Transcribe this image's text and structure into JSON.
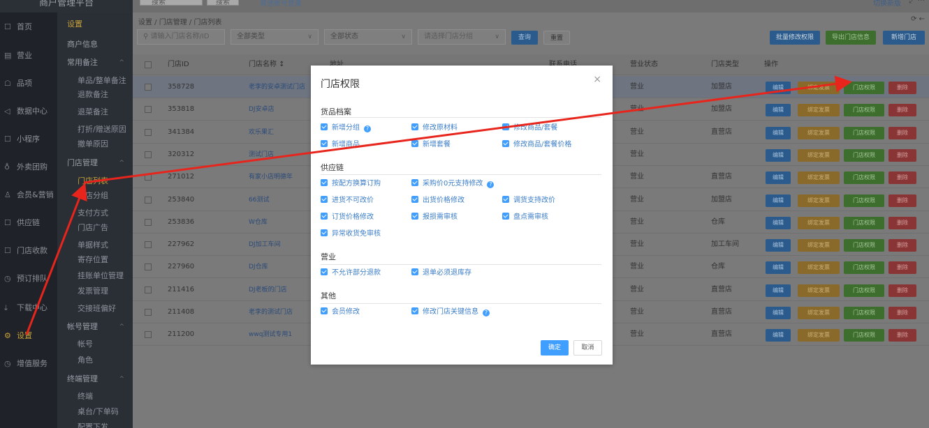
{
  "top": {
    "brand": "商户管理平台",
    "search_value": "搜索",
    "search_btn": "搜索",
    "link": "其他账号登录",
    "right_link": "切换新版",
    "right_icon": "⤢ ···"
  },
  "nav1": [
    {
      "label": "首页",
      "icon": "☐"
    },
    {
      "label": "营业",
      "icon": "▤"
    },
    {
      "label": "品项",
      "icon": "☖"
    },
    {
      "label": "数据中心",
      "icon": "◁"
    },
    {
      "label": "小程序",
      "icon": "☐"
    },
    {
      "label": "外卖团购",
      "icon": "♁"
    },
    {
      "label": "会员&营销",
      "icon": "♙"
    },
    {
      "label": "供应链",
      "icon": "☐"
    },
    {
      "label": "门店收款",
      "icon": "☐"
    },
    {
      "label": "预订排队",
      "icon": "◷"
    },
    {
      "label": "下载中心",
      "icon": "⤓"
    },
    {
      "label": "设置",
      "icon": "⚙"
    },
    {
      "label": "增值服务",
      "icon": "◷"
    }
  ],
  "nav2": {
    "title": "设置",
    "items": [
      {
        "label": "商户信息",
        "type": "grp"
      },
      {
        "label": "常用备注",
        "type": "grp",
        "caret": "^"
      },
      {
        "label": "单品/整单备注",
        "type": "sub"
      },
      {
        "label": "退款备注",
        "type": "sub"
      },
      {
        "label": "退菜备注",
        "type": "sub"
      },
      {
        "label": "打折/赠送原因",
        "type": "sub"
      },
      {
        "label": "撤单原因",
        "type": "sub"
      },
      {
        "label": "门店管理",
        "type": "grp",
        "caret": "^"
      },
      {
        "label": "门店列表",
        "type": "sub",
        "current": true
      },
      {
        "label": "门店分组",
        "type": "sub"
      },
      {
        "label": "支付方式",
        "type": "sub"
      },
      {
        "label": "门店广告",
        "type": "sub"
      },
      {
        "label": "单据样式",
        "type": "sub"
      },
      {
        "label": "寄存位置",
        "type": "sub"
      },
      {
        "label": "挂账单位管理",
        "type": "sub"
      },
      {
        "label": "发票管理",
        "type": "sub"
      },
      {
        "label": "交接班偏好",
        "type": "sub"
      },
      {
        "label": "帐号管理",
        "type": "grp",
        "caret": "^"
      },
      {
        "label": "帐号",
        "type": "sub"
      },
      {
        "label": "角色",
        "type": "sub"
      },
      {
        "label": "终端管理",
        "type": "grp",
        "caret": "^"
      },
      {
        "label": "终端",
        "type": "sub"
      },
      {
        "label": "桌台/下单码",
        "type": "sub"
      },
      {
        "label": "配置下发",
        "type": "sub"
      }
    ]
  },
  "breadcrumb": "设置 / 门店管理 / 门店列表",
  "breadcrumb_icons": "⟳ ←",
  "filters": {
    "search_placeholder": "请输入门店名称/ID",
    "type": "全部类型",
    "status": "全部状态",
    "group_placeholder": "请选择门店分组",
    "query": "查询",
    "reset": "重置",
    "batch": "批量修改权限",
    "export": "导出门店信息",
    "add": "新增门店"
  },
  "table": {
    "headers": [
      "门店ID",
      "门店名称 ↕",
      "地址",
      "联系电话",
      "营业状态",
      "门店类型",
      "操作"
    ],
    "op_labels": {
      "edit": "编辑",
      "bind": "绑定发票",
      "perm": "门店权限",
      "del": "删除"
    },
    "rows": [
      {
        "id": "358728",
        "name": "老李的安卓测试门店",
        "status": "营业",
        "type": "加盟店"
      },
      {
        "id": "353818",
        "name": "DJ安卓店",
        "status": "营业",
        "type": "加盟店"
      },
      {
        "id": "341384",
        "name": "欢乐果汇",
        "status": "营业",
        "type": "直营店"
      },
      {
        "id": "320312",
        "name": "测试门店",
        "status": "营业",
        "type": ""
      },
      {
        "id": "271012",
        "name": "有家小店明德年",
        "status": "营业",
        "type": "直营店"
      },
      {
        "id": "253840",
        "name": "66测试",
        "status": "营业",
        "type": "加盟店"
      },
      {
        "id": "253836",
        "name": "W仓库",
        "status": "营业",
        "type": "仓库"
      },
      {
        "id": "227962",
        "name": "DJ加工车间",
        "status": "营业",
        "type": "加工车间"
      },
      {
        "id": "227960",
        "name": "DJ仓库",
        "status": "营业",
        "type": "仓库"
      },
      {
        "id": "211416",
        "name": "DJ老板的门店",
        "status": "营业",
        "type": "直营店"
      },
      {
        "id": "211408",
        "name": "老李的测试门店",
        "status": "营业",
        "type": "直营店"
      },
      {
        "id": "211200",
        "name": "wwq测试专用1",
        "status": "营业",
        "type": "直营店"
      }
    ]
  },
  "modal": {
    "title": "门店权限",
    "close": "×",
    "sections": [
      {
        "title": "货品档案",
        "options": [
          {
            "label": "新增分组",
            "help": true
          },
          {
            "label": "修改原材料"
          },
          {
            "label": "修改商品/套餐"
          },
          {
            "label": "新增商品"
          },
          {
            "label": "新增套餐"
          },
          {
            "label": "修改商品/套餐价格"
          }
        ]
      },
      {
        "title": "供应链",
        "options": [
          {
            "label": "按配方换算订购"
          },
          {
            "label": "采购价0元支持修改",
            "help": true
          },
          {
            "label": "进货不可改价"
          },
          {
            "label": "出货价格修改"
          },
          {
            "label": "调货支持改价"
          },
          {
            "label": "订货价格修改"
          },
          {
            "label": "报损需审核"
          },
          {
            "label": "盘点需审核"
          },
          {
            "label": "异常收货免审核"
          }
        ]
      },
      {
        "title": "营业",
        "options": [
          {
            "label": "不允许部分退款"
          },
          {
            "label": "退单必须退库存"
          }
        ]
      },
      {
        "title": "其他",
        "options": [
          {
            "label": "会员修改"
          },
          {
            "label": "修改门店关键信息",
            "help": true
          }
        ]
      }
    ],
    "ok": "确定",
    "cancel": "取消"
  },
  "annotation_color": "#e8251c"
}
